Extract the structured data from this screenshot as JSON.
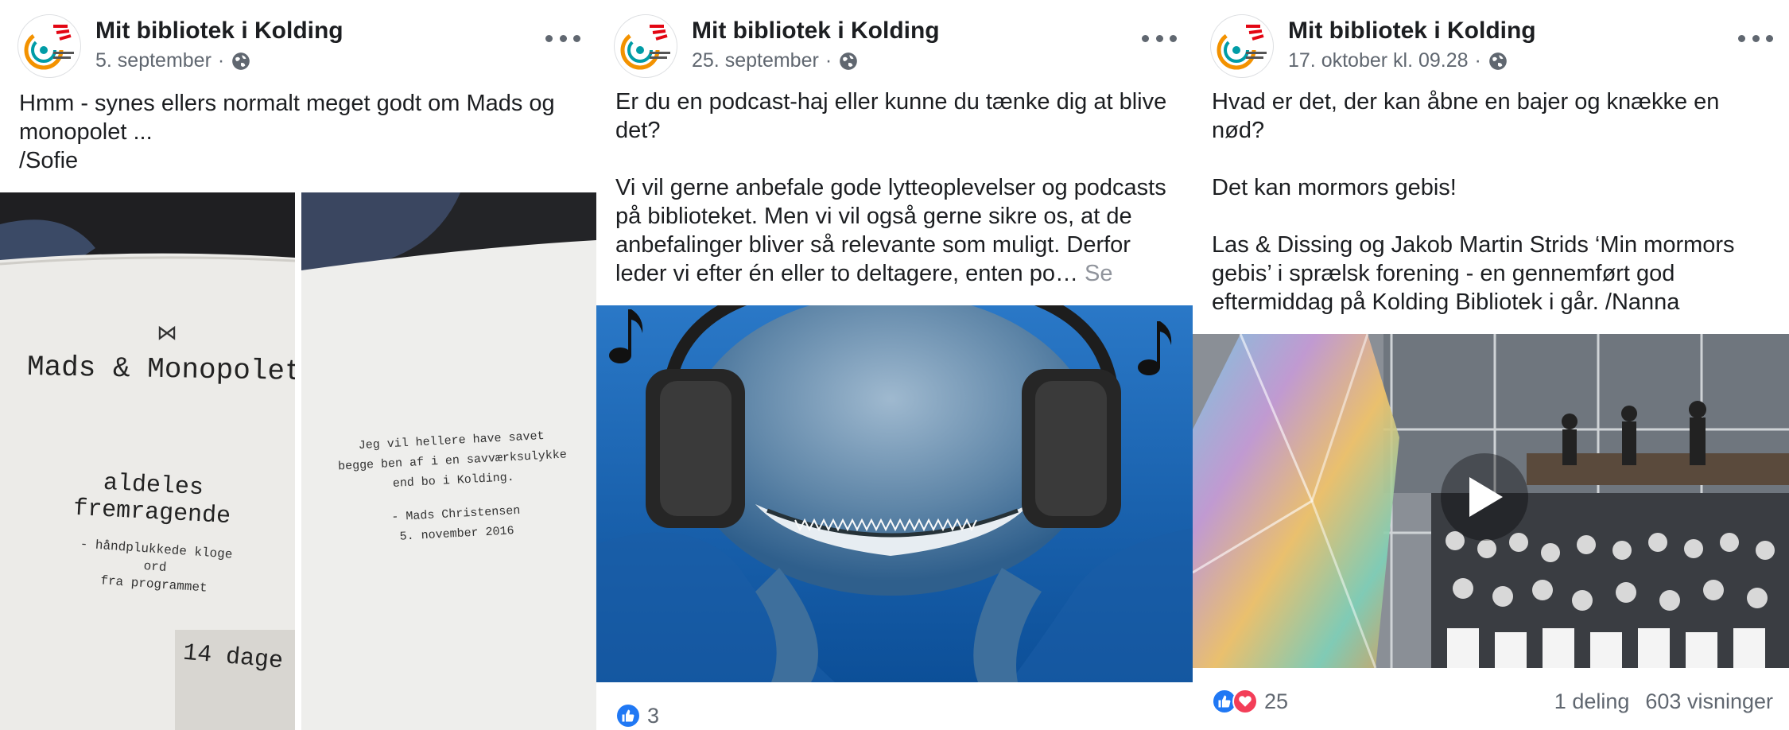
{
  "posts": [
    {
      "author": "Mit bibliotek i Kolding",
      "date": "5. september",
      "separator": "·",
      "privacy_icon": "globe-icon",
      "more_icon": "more-options-icon",
      "text": "Hmm - synes ellers normalt meget godt om Mads og monopolet ...\n/Sofie",
      "photo_left": {
        "title": "Mads & Monopolet",
        "heading": "aldeles\nfremragende",
        "sub": "- håndplukkede kloge ord\nfra programmet",
        "sticker": "14 dage"
      },
      "photo_right": {
        "quote": "Jeg vil hellere have savet\nbegge ben af i en savværksulykke\nend bo i Kolding.",
        "attribution": "- Mads Christensen\n5. november 2016"
      }
    },
    {
      "author": "Mit bibliotek i Kolding",
      "date": "25. september",
      "separator": "·",
      "privacy_icon": "globe-icon",
      "more_icon": "more-options-icon",
      "text": "Er du en podcast-haj eller kunne du tænke dig at blive det?\n\nVi vil gerne anbefale gode lytteoplevelser og podcasts på biblioteket. Men vi vil også gerne sikre os, at de anbefalinger bliver så relevante som muligt. Derfor leder vi efter én eller to deltagere, enten po…",
      "see_more": " Se mere",
      "reaction_icon": "like-icon",
      "reaction_count": "3"
    },
    {
      "author": "Mit bibliotek i Kolding",
      "date": "17. oktober kl. 09.28",
      "separator": "·",
      "privacy_icon": "globe-icon",
      "more_icon": "more-options-icon",
      "text": "Hvad er det, der kan åbne en bajer og knække en nød?\n\nDet kan mormors gebis!\n\nLas & Dissing og Jakob Martin Strids ‘Min mormors gebis’ i sprælsk forening - en gennemført god eftermiddag på Kolding Bibliotek i går. /Nanna",
      "reaction_icons": [
        "like-icon",
        "love-icon"
      ],
      "reaction_count": "25",
      "shares": "1 deling",
      "views": "603 visninger",
      "play_icon": "play-icon"
    }
  ],
  "colors": {
    "text": "#1c1e21",
    "meta": "#606770",
    "like": "#2078f4",
    "love": "#f33e58",
    "logo_orange": "#f39200",
    "logo_red": "#e30613",
    "logo_teal": "#009ca6"
  }
}
